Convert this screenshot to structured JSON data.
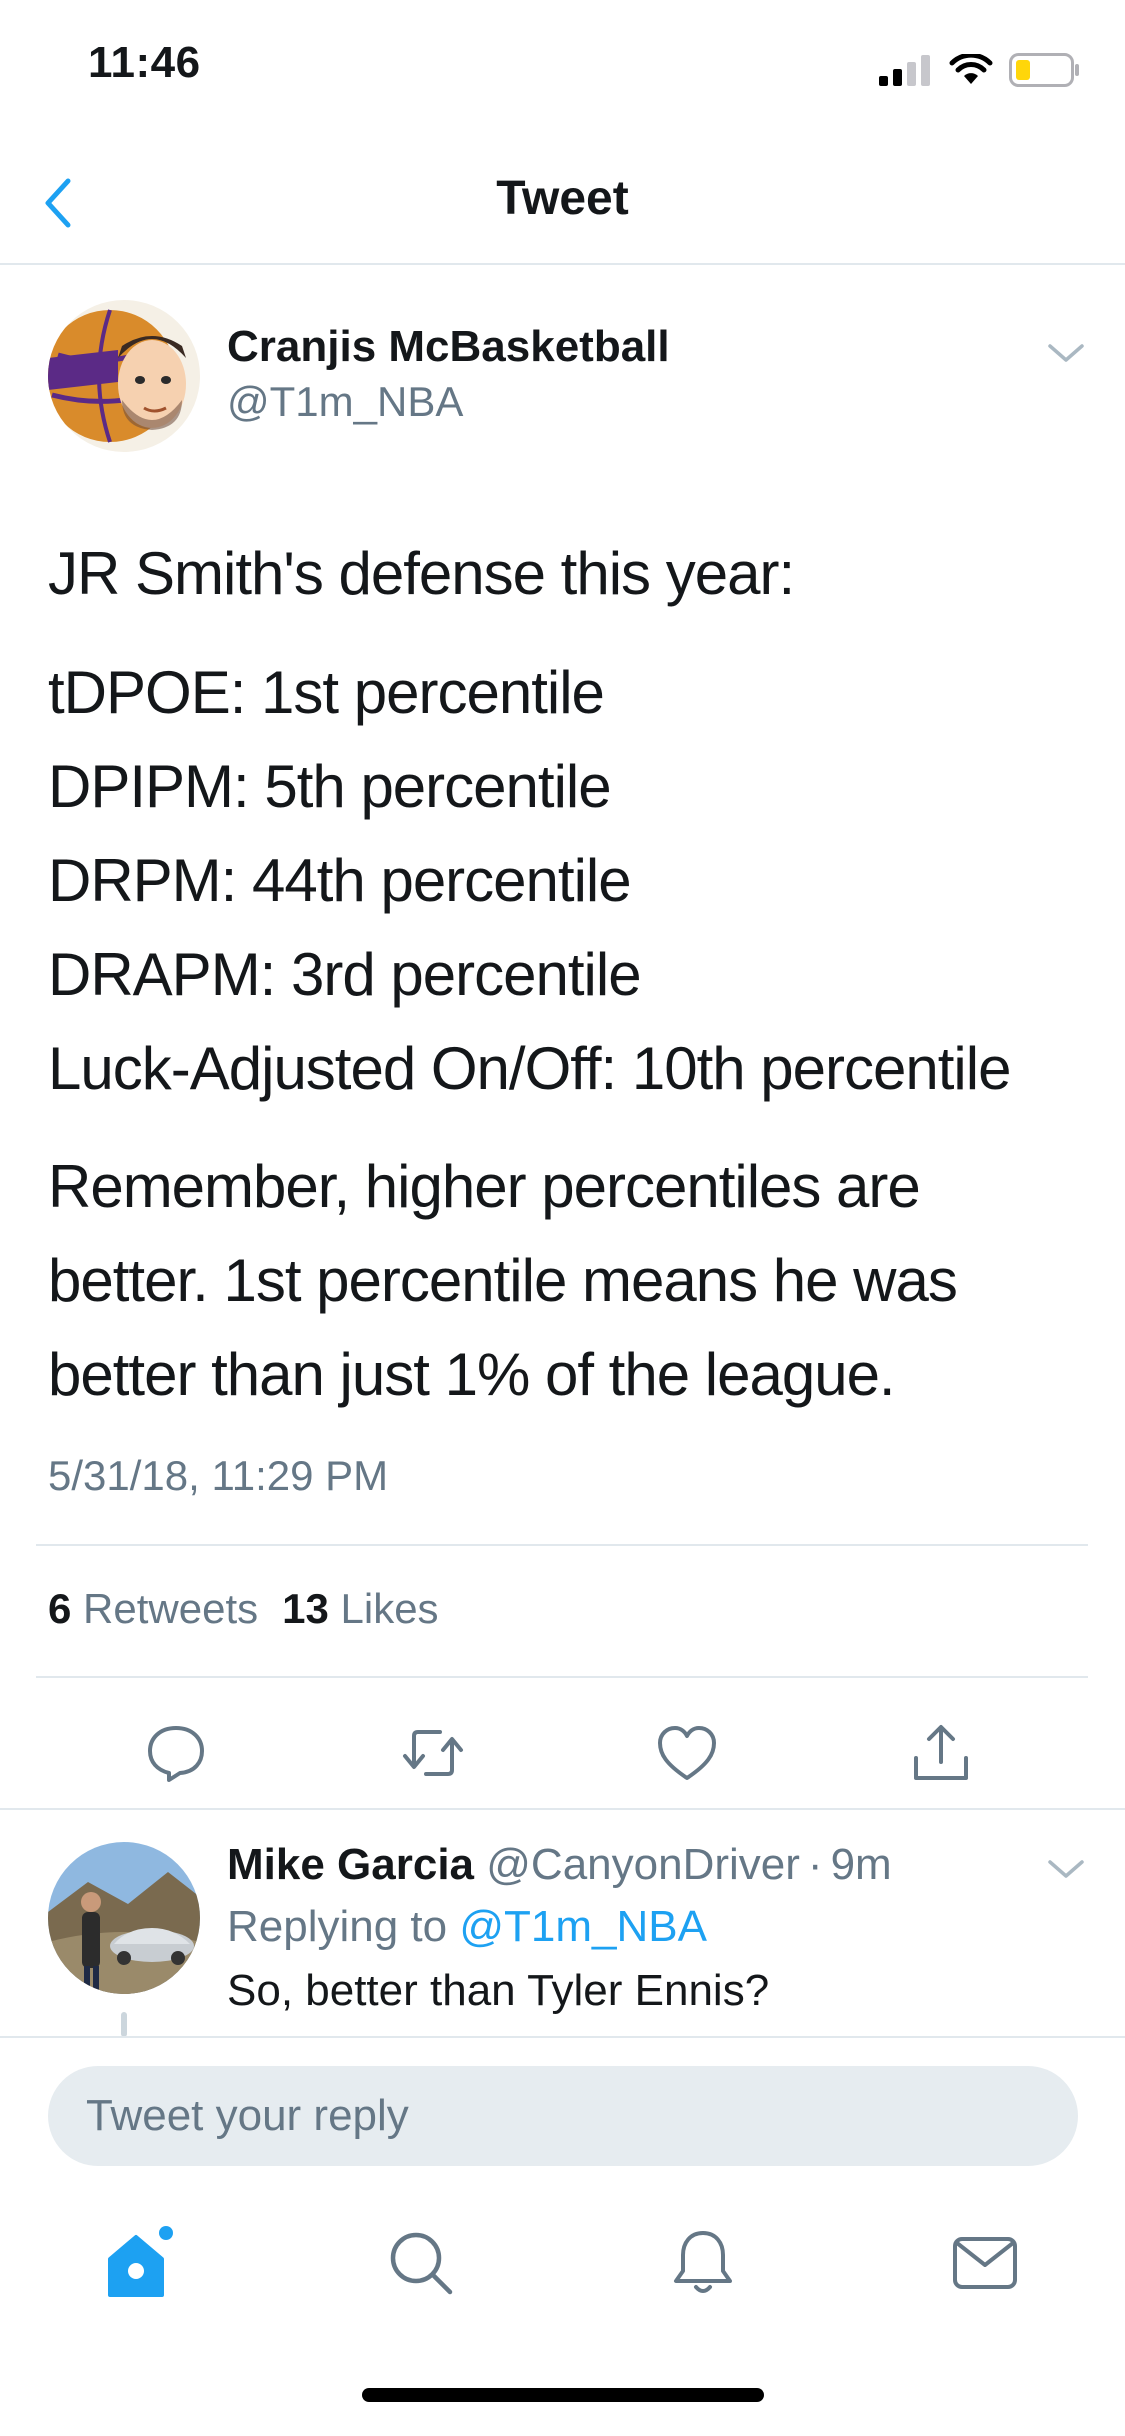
{
  "status_bar": {
    "time": "11:46"
  },
  "nav": {
    "title": "Tweet"
  },
  "tweet": {
    "author_name": "Cranjis McBasketball",
    "author_handle": "@T1m_NBA",
    "intro": "JR Smith's defense this year:",
    "stats": [
      "tDPOE: 1st percentile",
      "DPIPM: 5th percentile",
      "DRPM: 44th percentile",
      "DRAPM: 3rd percentile",
      "Luck-Adjusted On/Off: 10th percentile"
    ],
    "closing_lines": [
      "Remember, higher percentiles are",
      "better. 1st percentile means he was",
      "better than just 1% of the league."
    ],
    "timestamp": "5/31/18, 11:29 PM",
    "retweet_count": "6",
    "retweet_label": "Retweets",
    "like_count": "13",
    "like_label": "Likes"
  },
  "reply": {
    "author_name": "Mike Garcia",
    "author_handle": "@CanyonDriver",
    "separator": "·",
    "time_ago": "9m",
    "replying_prefix": "Replying to",
    "replying_to": "@T1m_NBA",
    "text": "So, better than Tyler Ennis?"
  },
  "composer": {
    "placeholder": "Tweet your reply"
  },
  "icons": {
    "back": "chevron-left-icon",
    "reply": "comment-icon",
    "retweet": "retweet-icon",
    "like": "heart-icon",
    "share": "share-icon",
    "home": "home-icon",
    "search": "search-icon",
    "notifications": "bell-icon",
    "messages": "mail-icon"
  },
  "colors": {
    "accent": "#1da1f2",
    "text": "#14171a",
    "muted": "#657786",
    "divider": "#e1e8ed",
    "input_bg": "#e6ecf0",
    "battery_low": "#ffd60a"
  }
}
